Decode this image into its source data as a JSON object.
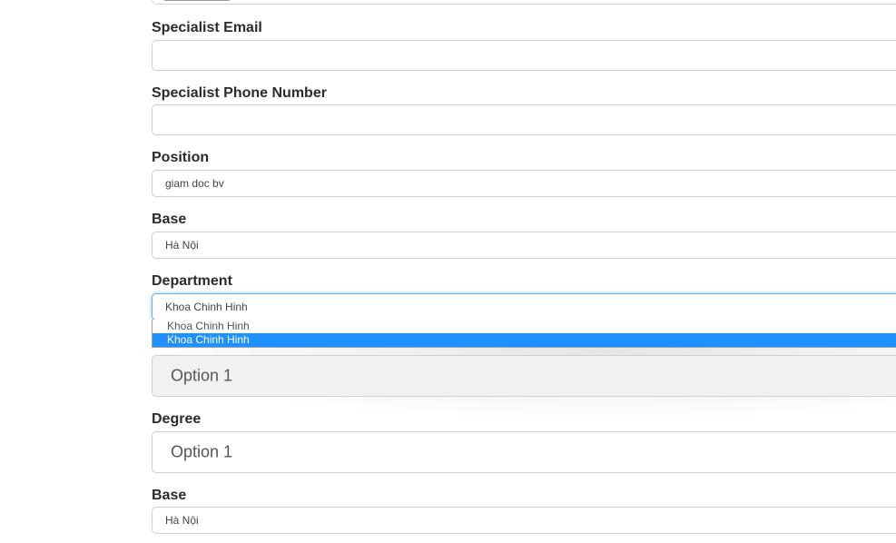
{
  "form": {
    "specialist_email": {
      "label": "Specialist Email",
      "value": ""
    },
    "specialist_phone": {
      "label": "Specialist Phone Number",
      "value": ""
    },
    "position": {
      "label": "Position",
      "value": "giam doc bv"
    },
    "base": {
      "label": "Base",
      "value": "Hà Nội"
    },
    "department": {
      "label": "Department",
      "value": "Khoa Chinh Hinh",
      "options": [
        "Khoa Chinh Hinh",
        "Khoa Chinh Hinh"
      ],
      "highlighted_index": 1
    },
    "hidden_field": {
      "label_visible": "A",
      "value": "Option 1"
    },
    "degree": {
      "label": "Degree",
      "value": "Option 1"
    },
    "base_2": {
      "label": "Base",
      "value": "Hà Nội"
    }
  },
  "colors": {
    "focus_border": "#66afe9",
    "highlight": "#1e90ff"
  }
}
